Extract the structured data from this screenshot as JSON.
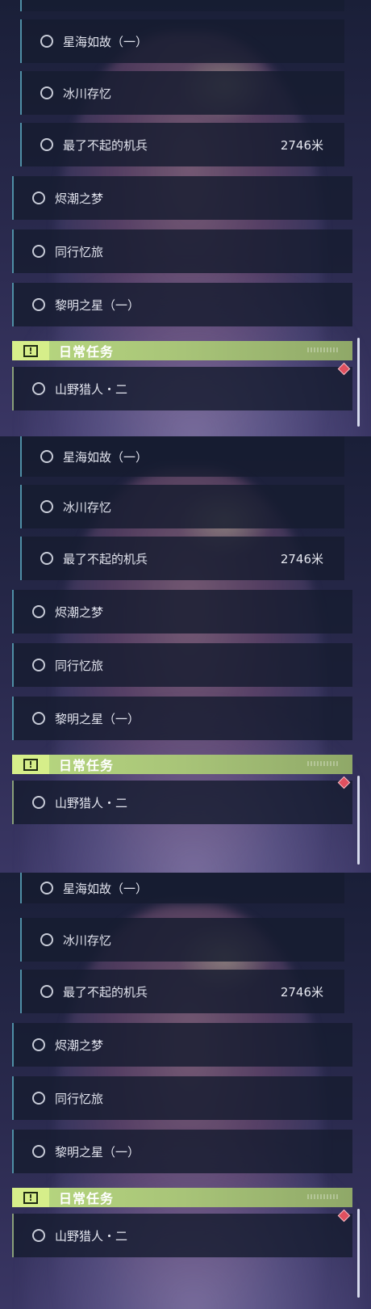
{
  "panels": [
    {
      "quests": [
        {
          "label": "星海如故（一）"
        },
        {
          "label": "冰川存忆"
        },
        {
          "label": "最了不起的机兵",
          "distance": "2746米"
        },
        {
          "label": "烬潮之梦"
        },
        {
          "label": "同行忆旅"
        },
        {
          "label": "黎明之星（一）"
        }
      ],
      "section_title": "日常任务",
      "section_icon": "exclamation-icon",
      "daily_quest": "山野猎人・二"
    },
    {
      "quests": [
        {
          "label": "星海如故（一）"
        },
        {
          "label": "冰川存忆"
        },
        {
          "label": "最了不起的机兵",
          "distance": "2746米"
        },
        {
          "label": "烬潮之梦"
        },
        {
          "label": "同行忆旅"
        },
        {
          "label": "黎明之星（一）"
        }
      ],
      "section_title": "日常任务",
      "section_icon": "exclamation-icon",
      "daily_quest": "山野猎人・二"
    },
    {
      "quests": [
        {
          "label": "星海如故（一）"
        },
        {
          "label": "冰川存忆"
        },
        {
          "label": "最了不起的机兵",
          "distance": "2746米"
        },
        {
          "label": "烬潮之梦"
        },
        {
          "label": "同行忆旅"
        },
        {
          "label": "黎明之星（一）"
        }
      ],
      "section_title": "日常任务",
      "section_icon": "exclamation-icon",
      "daily_quest": "山野猎人・二"
    }
  ],
  "colors": {
    "accent_blue": "#4f8fa6",
    "daily_header": "#b8d880",
    "marker_red": "#e0505f"
  }
}
